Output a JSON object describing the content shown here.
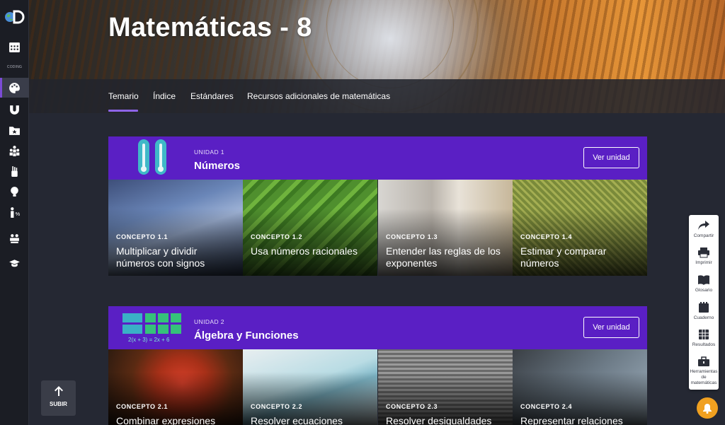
{
  "course": {
    "title": "Matemáticas - 8"
  },
  "tabs": [
    {
      "label": "Temario"
    },
    {
      "label": "Índice"
    },
    {
      "label": "Estándares"
    },
    {
      "label": "Recursos adicionales de matemáticas"
    }
  ],
  "sidebar": {
    "logo": "discovery-education-logo",
    "calendar_text": "CODING",
    "items": [
      {
        "icon": "calendar-icon"
      },
      {
        "icon": "palette-icon"
      },
      {
        "icon": "magnet-icon"
      },
      {
        "icon": "starred-folder-icon"
      },
      {
        "icon": "group-icon"
      },
      {
        "icon": "hand-raise-icon"
      },
      {
        "icon": "lightbulb-icon"
      },
      {
        "icon": "percent-person-icon"
      },
      {
        "icon": "classroom-icon"
      },
      {
        "icon": "graduation-cap-icon"
      }
    ]
  },
  "units": [
    {
      "eyebrow": "UNIDAD 1",
      "name": "Números",
      "button": "Ver unidad",
      "concepts": [
        {
          "label": "CONCEPTO 1.1",
          "title": "Multiplicar y dividir números con signos"
        },
        {
          "label": "CONCEPTO 1.2",
          "title": "Usa números racionales"
        },
        {
          "label": "CONCEPTO 1.3",
          "title": "Entender las reglas de los exponentes"
        },
        {
          "label": "CONCEPTO 1.4",
          "title": "Estimar y comparar números"
        }
      ]
    },
    {
      "eyebrow": "UNIDAD 2",
      "name": "Álgebra y Funciones",
      "button": "Ver unidad",
      "equation": "2(x + 3) = 2x + 6",
      "concepts": [
        {
          "label": "CONCEPTO 2.1",
          "title": "Combinar expresiones"
        },
        {
          "label": "CONCEPTO 2.2",
          "title": "Resolver ecuaciones"
        },
        {
          "label": "CONCEPTO 2.3",
          "title": "Resolver desigualdades"
        },
        {
          "label": "CONCEPTO 2.4",
          "title": "Representar relaciones"
        }
      ]
    }
  ],
  "tools": [
    {
      "label": "Compartir",
      "icon": "share-icon"
    },
    {
      "label": "Imprimir",
      "icon": "print-icon"
    },
    {
      "label": "Glosario",
      "icon": "book-icon"
    },
    {
      "label": "Cuaderno",
      "icon": "notebook-icon"
    },
    {
      "label": "Resultados",
      "icon": "results-grid-icon"
    },
    {
      "label": "Herramientas de matemáticas",
      "icon": "toolbox-icon"
    }
  ],
  "scroll_top": {
    "label": "SUBIR"
  },
  "colors": {
    "accent": "#5a1fc4",
    "tab_underline": "#8e65e8",
    "notification": "#f0a020"
  }
}
